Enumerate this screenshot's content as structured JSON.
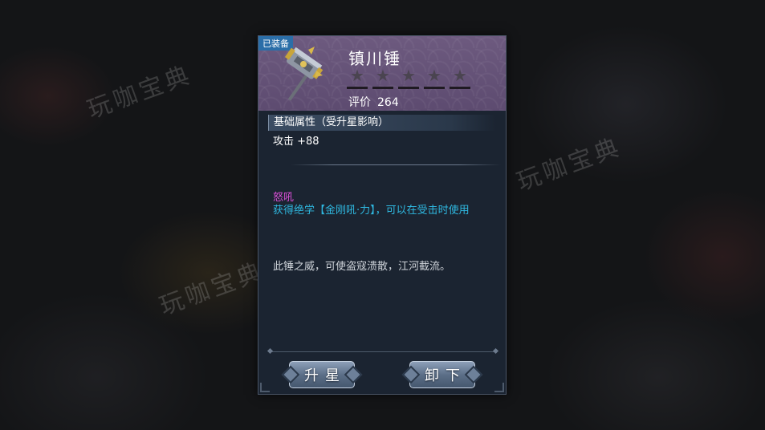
{
  "watermark_text": "玩咖宝典",
  "item": {
    "equipped_tag": "已装备",
    "name": "镇川锤",
    "star_count_total": 5,
    "stars_filled": 0,
    "rating_label": "评价",
    "rating_value": "264",
    "weapon_icon": "hammer-weapon-icon"
  },
  "base_attributes": {
    "header": "基础属性（受升星影响）",
    "attack": "攻击 +88"
  },
  "skill": {
    "name": "怒吼",
    "description": "获得绝学【金刚吼·力】，可以在受击时使用"
  },
  "flavor_text": "此锤之威，可使盗寇溃散，江河截流。",
  "buttons": {
    "upgrade": "升星",
    "unequip": "卸下"
  },
  "colors": {
    "header_bg": "#6d5a7f",
    "panel_bg": "#1b2431",
    "skill_name": "#d94fd6",
    "skill_desc": "#2fb8e0",
    "equipped_tag_bg": "#2b6ea8"
  }
}
